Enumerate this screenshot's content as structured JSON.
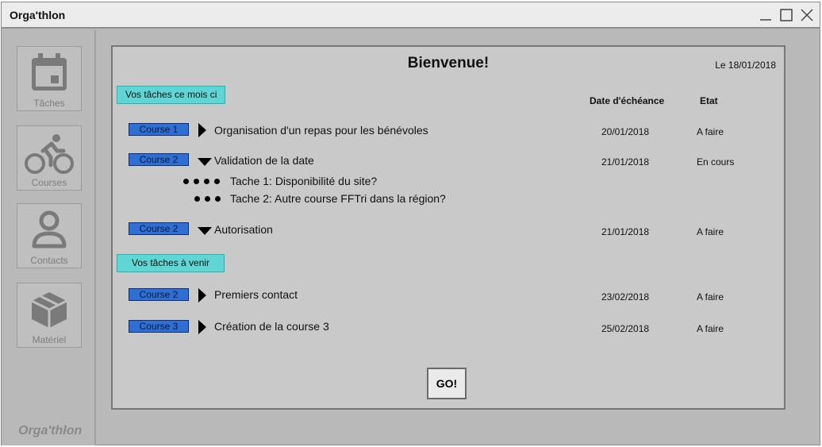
{
  "window": {
    "title": "Orga'thlon"
  },
  "sidebar": {
    "items": [
      {
        "label": "Tâches",
        "icon": "calendar-icon"
      },
      {
        "label": "Courses",
        "icon": "cyclist-icon"
      },
      {
        "label": "Contacts",
        "icon": "person-icon"
      },
      {
        "label": "Matériel",
        "icon": "box-icon"
      }
    ],
    "brand": "Orga'thlon"
  },
  "panel": {
    "welcome": "Bienvenue!",
    "date": "Le 18/01/2018",
    "columns": {
      "due": "Date d'échéance",
      "status": "Etat"
    },
    "sections": [
      {
        "title": "Vos tâches ce mois ci",
        "tasks": [
          {
            "badge": "Course 1",
            "label": "Organisation d'un repas pour les bénévoles",
            "due": "20/01/2018",
            "status": "A faire",
            "expanded": false
          },
          {
            "badge": "Course 2",
            "label": "Validation de la date",
            "due": "21/01/2018",
            "status": "En cours",
            "expanded": true,
            "subtasks": [
              "Tache 1: Disponibilité du site?",
              "Tache 2: Autre course FFTri dans la région?"
            ]
          },
          {
            "badge": "Course 2",
            "label": "Autorisation",
            "due": "21/01/2018",
            "status": "A faire",
            "expanded": true
          }
        ]
      },
      {
        "title": "Vos tâches à venir",
        "tasks": [
          {
            "badge": "Course 2",
            "label": "Premiers contact",
            "due": "23/02/2018",
            "status": "A faire",
            "expanded": false
          },
          {
            "badge": "Course 3",
            "label": "Création de la course 3",
            "due": "25/02/2018",
            "status": "A faire",
            "expanded": false
          }
        ]
      }
    ],
    "go_label": "GO!"
  },
  "colors": {
    "section_tag": "#5fd6d4",
    "badge": "#2f6fd4",
    "panel": "#c9c9c9"
  }
}
